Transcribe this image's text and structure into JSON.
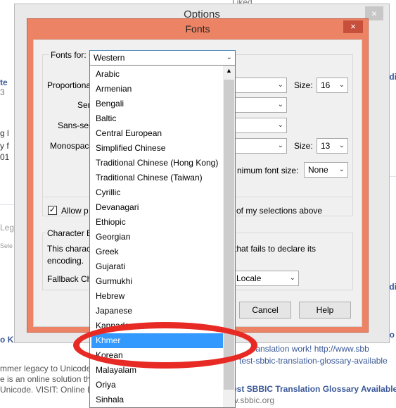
{
  "options_window": {
    "title": "Options",
    "close": "×"
  },
  "fonts_dialog": {
    "title": "Fonts",
    "close": "×",
    "fonts_for_label": "Fonts for:",
    "fonts_for_value": "Western",
    "proportional_label": "Proportional",
    "serif_label": "Seri",
    "sans_serif_label": "Sans-seri",
    "monospace_label": "Monospace",
    "size_label_1": "Size:",
    "size_value_1": "16",
    "size_label_2": "Size:",
    "size_value_2": "13",
    "min_font_label": "nimum font size:",
    "min_font_value": "None",
    "allow_label": "Allow p",
    "allow_tail": "of my selections above",
    "allow_checked": "✓",
    "char_enc_label": "Character En",
    "char_enc_desc_1": "This charact",
    "char_enc_desc_1_tail": "that fails to declare its",
    "char_enc_desc_2": "encoding.",
    "fallback_label": "Fallback Ch",
    "fallback_value": "Locale",
    "cancel_label": "Cancel",
    "help_label": "Help"
  },
  "dropdown": {
    "items": [
      "Arabic",
      "Armenian",
      "Bengali",
      "Baltic",
      "Central European",
      "Simplified Chinese",
      "Traditional Chinese (Hong Kong)",
      "Traditional Chinese (Taiwan)",
      "Cyrillic",
      "Devanagari",
      "Ethiopic",
      "Georgian",
      "Greek",
      "Gujarati",
      "Gurmukhi",
      "Hebrew",
      "Japanese",
      "Kannada",
      "Khmer",
      "Korean",
      "Malayalam",
      "Oriya",
      "Sinhala"
    ],
    "selected": "Khmer"
  },
  "background": {
    "partial_top": "Liked",
    "partial_d": "d",
    "left_te": "te",
    "left_3": "3",
    "left_g": "g l",
    "left_yf": "y f",
    "left_01": "01",
    "left_leg": "Leg",
    "left_sele": "Sele",
    "bottom_k": "o K",
    "bottom_mmer": "mmer legacy to Unicode con",
    "bottom_online": "e is an online solution that w",
    "bottom_unicode": "Unicode. VISIT: Online Leg",
    "right_translation": "translation work! http://www.sbb",
    "right_glossary": "test-sbbic-translation-glossary-available",
    "right_title": "est SBBIC Translation Glossary Available",
    "right_url": "w.sbbic.org",
    "right_odia_1": "odia",
    "right_odia_2": "odia",
    "right_ko": "Ko",
    "right_k": "K"
  }
}
